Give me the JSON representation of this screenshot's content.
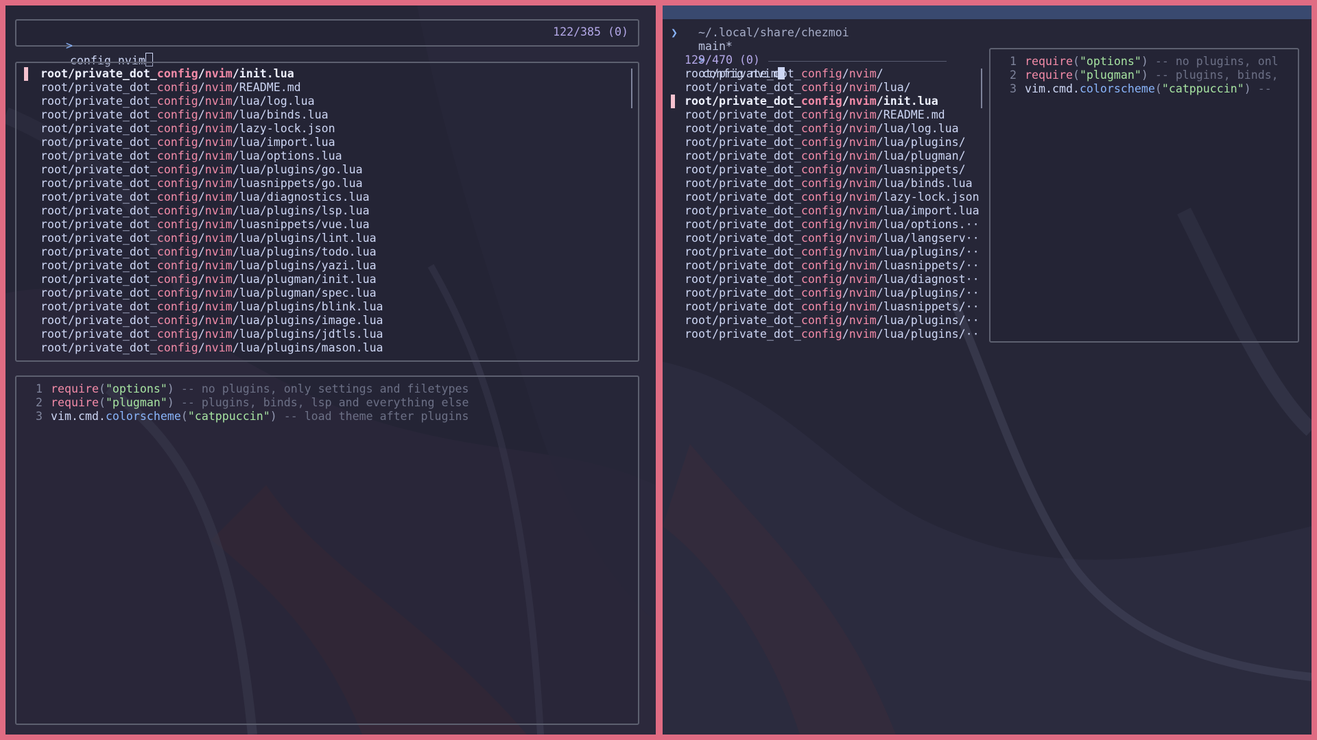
{
  "colors": {
    "frame_border": "#e06c83",
    "terminal_bg": "#262637",
    "path_highlight": "#f38ba8",
    "selection_marker": "#f5c2cf",
    "prompt_blue": "#89b4fa"
  },
  "left": {
    "prompt_symbol": ">",
    "query": "config nvim",
    "match_count": "122/385 (0)",
    "results": [
      {
        "pre": "root/private_dot_",
        "m1": "config",
        "mid": "/",
        "m2": "nvim",
        "post": "/init.lua"
      },
      {
        "pre": "root/private_dot_",
        "m1": "config",
        "mid": "/",
        "m2": "nvim",
        "post": "/README.md"
      },
      {
        "pre": "root/private_dot_",
        "m1": "config",
        "mid": "/",
        "m2": "nvim",
        "post": "/lua/log.lua"
      },
      {
        "pre": "root/private_dot_",
        "m1": "config",
        "mid": "/",
        "m2": "nvim",
        "post": "/lua/binds.lua"
      },
      {
        "pre": "root/private_dot_",
        "m1": "config",
        "mid": "/",
        "m2": "nvim",
        "post": "/lazy-lock.json"
      },
      {
        "pre": "root/private_dot_",
        "m1": "config",
        "mid": "/",
        "m2": "nvim",
        "post": "/lua/import.lua"
      },
      {
        "pre": "root/private_dot_",
        "m1": "config",
        "mid": "/",
        "m2": "nvim",
        "post": "/lua/options.lua"
      },
      {
        "pre": "root/private_dot_",
        "m1": "config",
        "mid": "/",
        "m2": "nvim",
        "post": "/lua/plugins/go.lua"
      },
      {
        "pre": "root/private_dot_",
        "m1": "config",
        "mid": "/",
        "m2": "nvim",
        "post": "/luasnippets/go.lua"
      },
      {
        "pre": "root/private_dot_",
        "m1": "config",
        "mid": "/",
        "m2": "nvim",
        "post": "/lua/diagnostics.lua"
      },
      {
        "pre": "root/private_dot_",
        "m1": "config",
        "mid": "/",
        "m2": "nvim",
        "post": "/lua/plugins/lsp.lua"
      },
      {
        "pre": "root/private_dot_",
        "m1": "config",
        "mid": "/",
        "m2": "nvim",
        "post": "/luasnippets/vue.lua"
      },
      {
        "pre": "root/private_dot_",
        "m1": "config",
        "mid": "/",
        "m2": "nvim",
        "post": "/lua/plugins/lint.lua"
      },
      {
        "pre": "root/private_dot_",
        "m1": "config",
        "mid": "/",
        "m2": "nvim",
        "post": "/lua/plugins/todo.lua"
      },
      {
        "pre": "root/private_dot_",
        "m1": "config",
        "mid": "/",
        "m2": "nvim",
        "post": "/lua/plugins/yazi.lua"
      },
      {
        "pre": "root/private_dot_",
        "m1": "config",
        "mid": "/",
        "m2": "nvim",
        "post": "/lua/plugman/init.lua"
      },
      {
        "pre": "root/private_dot_",
        "m1": "config",
        "mid": "/",
        "m2": "nvim",
        "post": "/lua/plugman/spec.lua"
      },
      {
        "pre": "root/private_dot_",
        "m1": "config",
        "mid": "/",
        "m2": "nvim",
        "post": "/lua/plugins/blink.lua"
      },
      {
        "pre": "root/private_dot_",
        "m1": "config",
        "mid": "/",
        "m2": "nvim",
        "post": "/lua/plugins/image.lua"
      },
      {
        "pre": "root/private_dot_",
        "m1": "config",
        "mid": "/",
        "m2": "nvim",
        "post": "/lua/plugins/jdtls.lua"
      },
      {
        "pre": "root/private_dot_",
        "m1": "config",
        "mid": "/",
        "m2": "nvim",
        "post": "/lua/plugins/mason.lua"
      }
    ],
    "preview": [
      {
        "num": "1",
        "fn": "require",
        "open": "(",
        "str": "\"options\"",
        "close": ")",
        "comment": " -- no plugins, only settings and filetypes"
      },
      {
        "num": "2",
        "fn": "require",
        "open": "(",
        "str": "\"plugman\"",
        "close": ")",
        "comment": " -- plugins, binds, lsp and everything else"
      },
      {
        "num": "3",
        "obj": "vim.cmd.",
        "field": "colorscheme",
        "open": "(",
        "str": "\"catppuccin\"",
        "close": ")",
        "comment": " -- load theme after plugins"
      }
    ]
  },
  "right": {
    "cwd": "~/.local/share/chezmoi",
    "branch": "main*",
    "shell_prompt": "❯",
    "prompt_symbol": ">",
    "query": "config nvim",
    "match_count": "129/470 (0)",
    "results": [
      {
        "pre": "root/private_dot_",
        "m1": "config",
        "mid": "/",
        "m2": "nvim",
        "post": "/"
      },
      {
        "pre": "root/private_dot_",
        "m1": "config",
        "mid": "/",
        "m2": "nvim",
        "post": "/lua/"
      },
      {
        "pre": "root/private_dot_",
        "m1": "config",
        "mid": "/",
        "m2": "nvim",
        "post": "/init.lua"
      },
      {
        "pre": "root/private_dot_",
        "m1": "config",
        "mid": "/",
        "m2": "nvim",
        "post": "/README.md"
      },
      {
        "pre": "root/private_dot_",
        "m1": "config",
        "mid": "/",
        "m2": "nvim",
        "post": "/lua/log.lua"
      },
      {
        "pre": "root/private_dot_",
        "m1": "config",
        "mid": "/",
        "m2": "nvim",
        "post": "/lua/plugins/"
      },
      {
        "pre": "root/private_dot_",
        "m1": "config",
        "mid": "/",
        "m2": "nvim",
        "post": "/lua/plugman/"
      },
      {
        "pre": "root/private_dot_",
        "m1": "config",
        "mid": "/",
        "m2": "nvim",
        "post": "/luasnippets/"
      },
      {
        "pre": "root/private_dot_",
        "m1": "config",
        "mid": "/",
        "m2": "nvim",
        "post": "/lua/binds.lua"
      },
      {
        "pre": "root/private_dot_",
        "m1": "config",
        "mid": "/",
        "m2": "nvim",
        "post": "/lazy-lock.json"
      },
      {
        "pre": "root/private_dot_",
        "m1": "config",
        "mid": "/",
        "m2": "nvim",
        "post": "/lua/import.lua"
      },
      {
        "pre": "root/private_dot_",
        "m1": "config",
        "mid": "/",
        "m2": "nvim",
        "post": "/lua/options.··"
      },
      {
        "pre": "root/private_dot_",
        "m1": "config",
        "mid": "/",
        "m2": "nvim",
        "post": "/lua/langserv··"
      },
      {
        "pre": "root/private_dot_",
        "m1": "config",
        "mid": "/",
        "m2": "nvim",
        "post": "/lua/plugins/··"
      },
      {
        "pre": "root/private_dot_",
        "m1": "config",
        "mid": "/",
        "m2": "nvim",
        "post": "/luasnippets/··"
      },
      {
        "pre": "root/private_dot_",
        "m1": "config",
        "mid": "/",
        "m2": "nvim",
        "post": "/lua/diagnost··"
      },
      {
        "pre": "root/private_dot_",
        "m1": "config",
        "mid": "/",
        "m2": "nvim",
        "post": "/lua/plugins/··"
      },
      {
        "pre": "root/private_dot_",
        "m1": "config",
        "mid": "/",
        "m2": "nvim",
        "post": "/luasnippets/··"
      },
      {
        "pre": "root/private_dot_",
        "m1": "config",
        "mid": "/",
        "m2": "nvim",
        "post": "/lua/plugins/··"
      },
      {
        "pre": "root/private_dot_",
        "m1": "config",
        "mid": "/",
        "m2": "nvim",
        "post": "/lua/plugins/··"
      }
    ],
    "preview": [
      {
        "num": "1",
        "fn": "require",
        "open": "(",
        "str": "\"options\"",
        "close": ")",
        "comment": " -- no plugins, onl"
      },
      {
        "num": "2",
        "fn": "require",
        "open": "(",
        "str": "\"plugman\"",
        "close": ")",
        "comment": " -- plugins, binds,"
      },
      {
        "num": "3",
        "obj": "vim.cmd.",
        "field": "colorscheme",
        "open": "(",
        "str": "\"catppuccin\"",
        "close": ")",
        "comment": " --"
      }
    ]
  }
}
